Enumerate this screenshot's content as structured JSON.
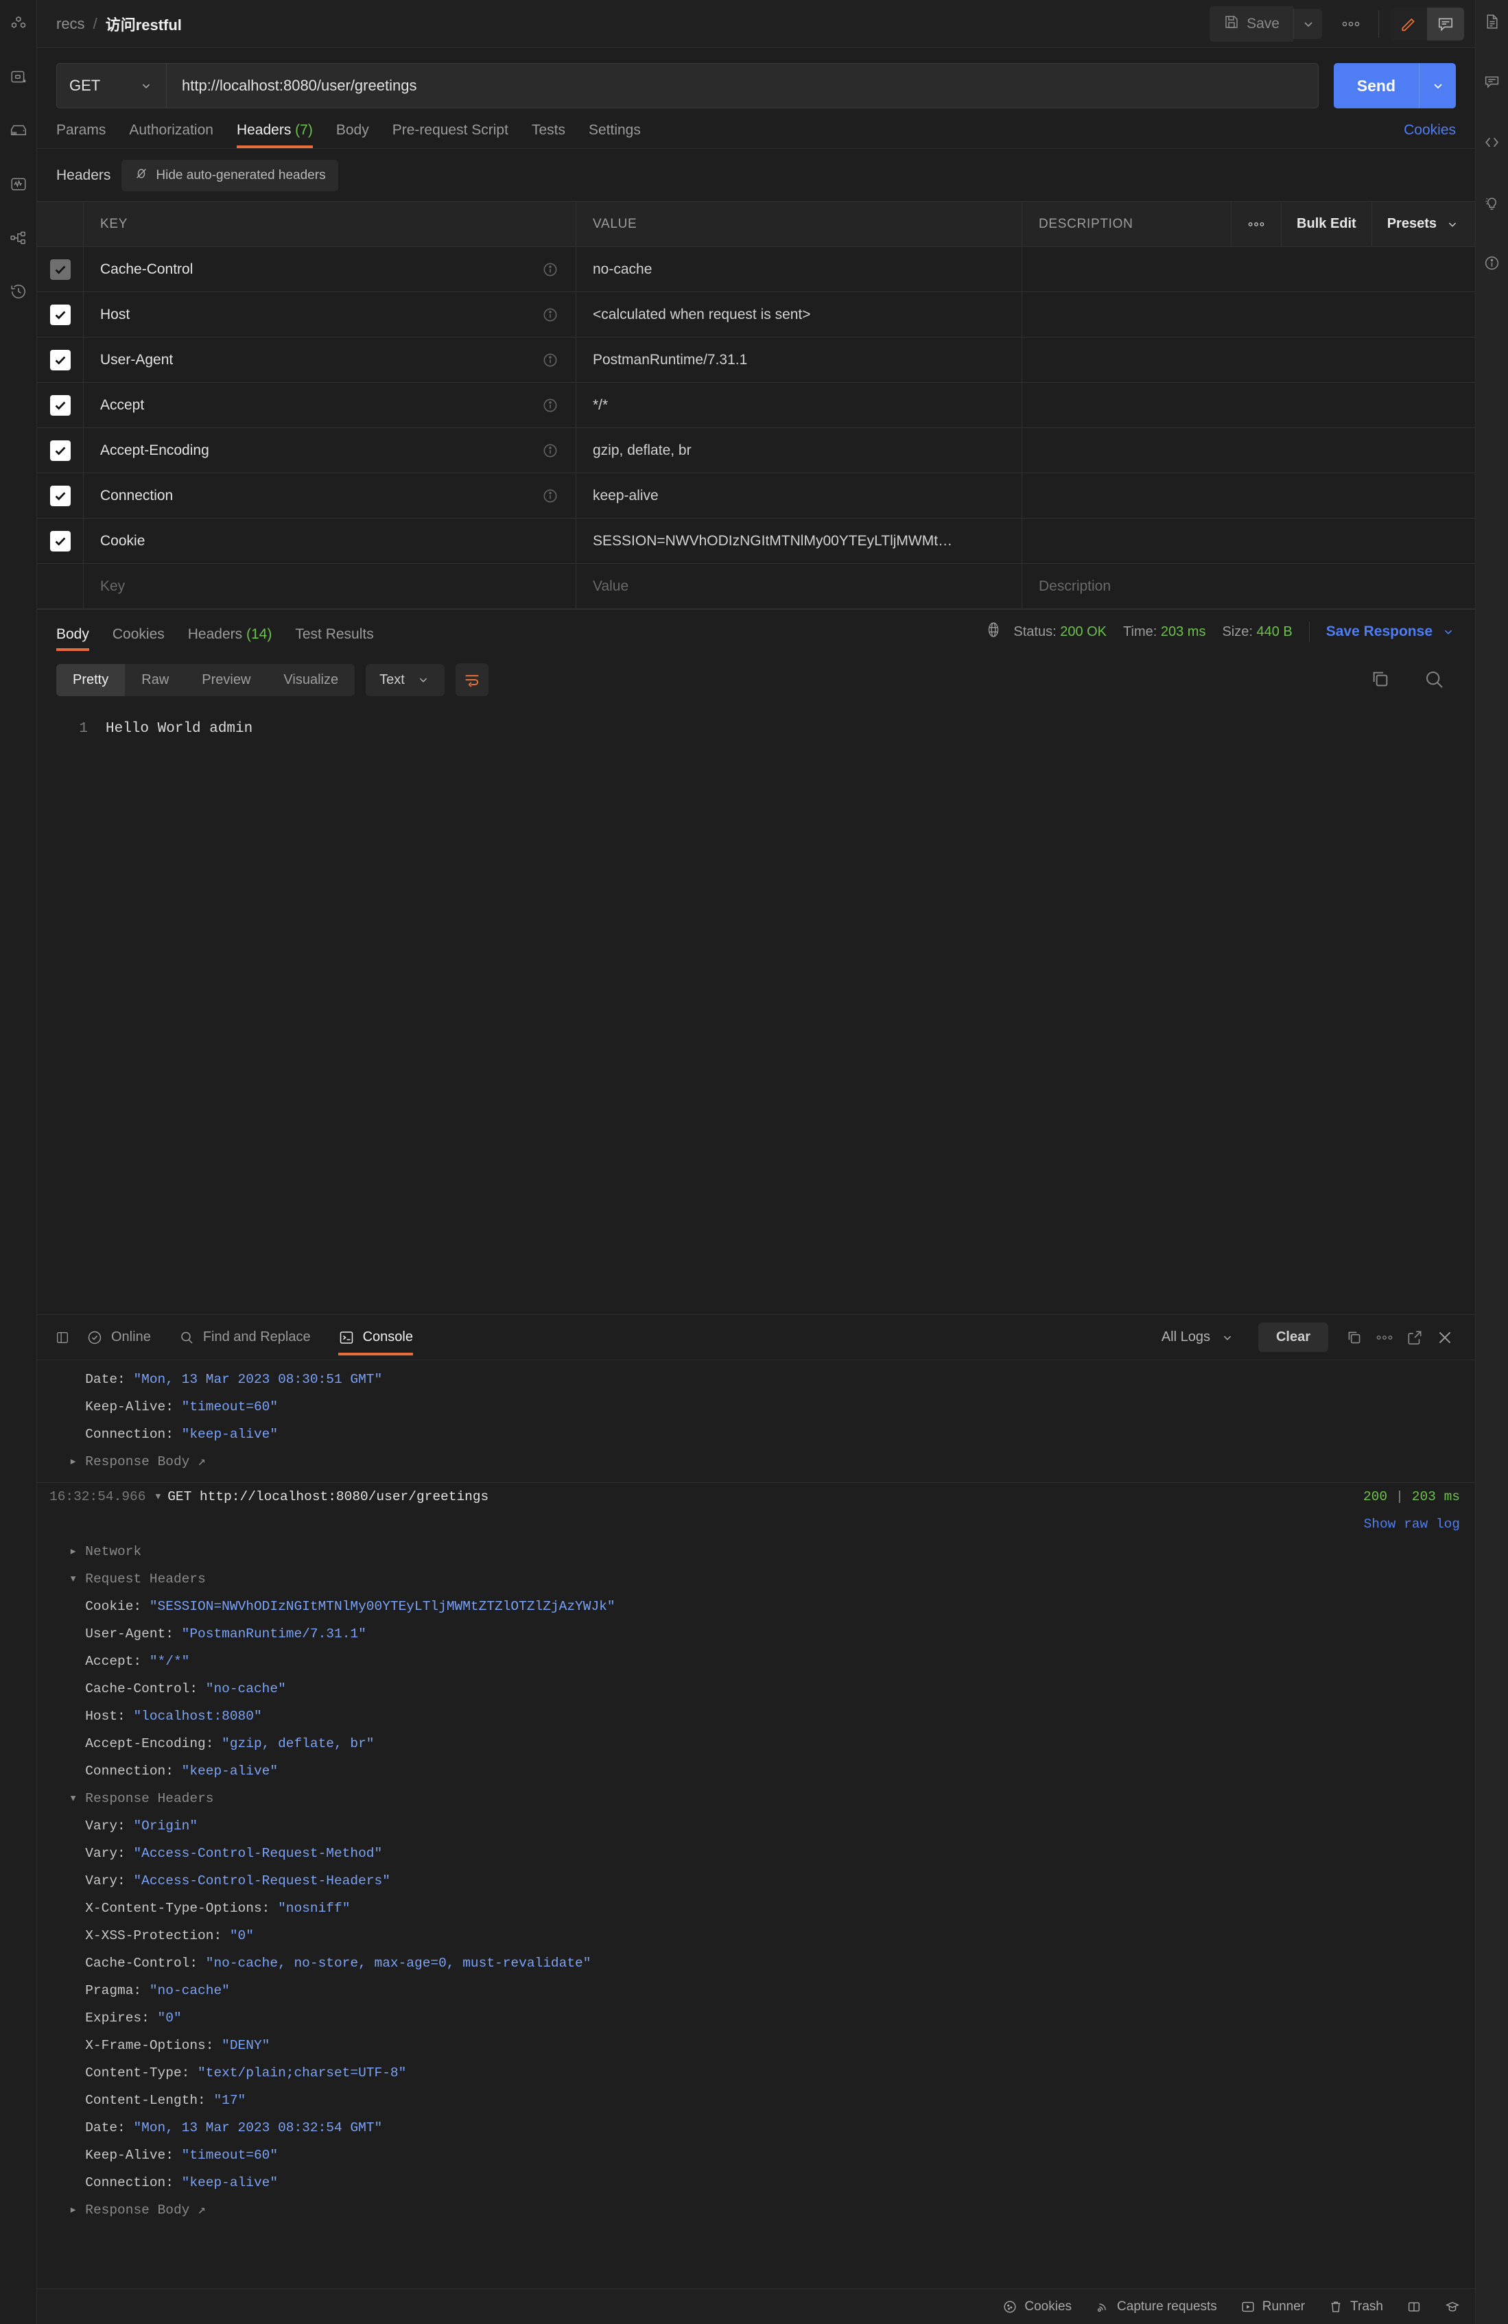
{
  "left_rail": [
    {
      "name": "collections-icon"
    },
    {
      "name": "apis-icon"
    },
    {
      "name": "environments-icon"
    },
    {
      "name": "monitors-icon"
    },
    {
      "name": "flows-icon"
    },
    {
      "name": "history-icon"
    }
  ],
  "right_rail": [
    {
      "name": "documentation-icon"
    },
    {
      "name": "comments-icon"
    },
    {
      "name": "code-icon"
    },
    {
      "name": "lightbulb-icon"
    },
    {
      "name": "info-icon"
    }
  ],
  "topbar": {
    "breadcrumb_root": "recs",
    "breadcrumb_sep": "/",
    "breadcrumb_current": "访问restful",
    "save_label": "Save"
  },
  "request": {
    "method": "GET",
    "url": "http://localhost:8080/user/greetings",
    "send_label": "Send",
    "tabs": [
      {
        "label": "Params",
        "count": "",
        "active": false
      },
      {
        "label": "Authorization",
        "count": "",
        "active": false
      },
      {
        "label": "Headers",
        "count": "(7)",
        "active": true
      },
      {
        "label": "Body",
        "count": "",
        "active": false
      },
      {
        "label": "Pre-request Script",
        "count": "",
        "active": false
      },
      {
        "label": "Tests",
        "count": "",
        "active": false
      },
      {
        "label": "Settings",
        "count": "",
        "active": false
      }
    ],
    "cookies_link": "Cookies",
    "headers_label": "Headers",
    "hide_auto_label": "Hide auto-generated headers",
    "table": {
      "columns": [
        "KEY",
        "VALUE",
        "DESCRIPTION"
      ],
      "bulk_edit_label": "Bulk Edit",
      "presets_label": "Presets",
      "key_placeholder": "Key",
      "value_placeholder": "Value",
      "description_placeholder": "Description",
      "rows": [
        {
          "checked": true,
          "dim": true,
          "key": "Cache-Control",
          "value": "no-cache",
          "info": true,
          "description": ""
        },
        {
          "checked": true,
          "dim": false,
          "key": "Host",
          "value": "<calculated when request is sent>",
          "info": true,
          "description": ""
        },
        {
          "checked": true,
          "dim": false,
          "key": "User-Agent",
          "value": "PostmanRuntime/7.31.1",
          "info": true,
          "description": ""
        },
        {
          "checked": true,
          "dim": false,
          "key": "Accept",
          "value": "*/*",
          "info": true,
          "description": ""
        },
        {
          "checked": true,
          "dim": false,
          "key": "Accept-Encoding",
          "value": "gzip, deflate, br",
          "info": true,
          "description": ""
        },
        {
          "checked": true,
          "dim": false,
          "key": "Connection",
          "value": "keep-alive",
          "info": true,
          "description": ""
        },
        {
          "checked": true,
          "dim": false,
          "key": "Cookie",
          "value": "SESSION=NWVhODIzNGItMTNlMy00YTEyLTljMWMt…",
          "info": false,
          "description": ""
        }
      ]
    }
  },
  "response": {
    "tabs": [
      {
        "label": "Body",
        "count": "",
        "active": true
      },
      {
        "label": "Cookies",
        "count": "",
        "active": false
      },
      {
        "label": "Headers",
        "count": "(14)",
        "active": false
      },
      {
        "label": "Test Results",
        "count": "",
        "active": false
      }
    ],
    "status_label": "Status:",
    "status_value": "200 OK",
    "time_label": "Time:",
    "time_value": "203 ms",
    "size_label": "Size:",
    "size_value": "440 B",
    "save_response_label": "Save Response",
    "view_modes": [
      {
        "label": "Pretty",
        "active": true
      },
      {
        "label": "Raw",
        "active": false
      },
      {
        "label": "Preview",
        "active": false
      },
      {
        "label": "Visualize",
        "active": false
      }
    ],
    "format_selected": "Text",
    "body_line_number": "1",
    "body_text": "Hello World admin"
  },
  "console": {
    "bottom_tabs": [
      {
        "label": "Online",
        "icon": "online-check-icon",
        "active": false
      },
      {
        "label": "Find and Replace",
        "icon": "search-icon",
        "active": false
      },
      {
        "label": "Console",
        "icon": "console-icon",
        "active": true
      }
    ],
    "filter_label": "All Logs",
    "clear_label": "Clear",
    "previous_entry_tail": [
      {
        "key": "Date:",
        "value": "\"Mon, 13 Mar 2023 08:30:51 GMT\"",
        "indent": 3
      },
      {
        "key": "Keep-Alive:",
        "value": "\"timeout=60\"",
        "indent": 3
      },
      {
        "key": "Connection:",
        "value": "\"keep-alive\"",
        "indent": 3
      }
    ],
    "previous_response_body_label": "Response Body",
    "entry": {
      "timestamp": "16:32:54.966",
      "title": "GET http://localhost:8080/user/greetings",
      "status": "200",
      "time": "203 ms",
      "raw_log_label": "Show raw log",
      "network_label": "Network",
      "request_headers_label": "Request Headers",
      "request_headers": [
        {
          "key": "Cookie:",
          "value": "\"SESSION=NWVhODIzNGItMTNlMy00YTEyLTljMWMtZTZlOTZlZjAzYWJk\""
        },
        {
          "key": "User-Agent:",
          "value": "\"PostmanRuntime/7.31.1\""
        },
        {
          "key": "Accept:",
          "value": "\"*/*\""
        },
        {
          "key": "Cache-Control:",
          "value": "\"no-cache\""
        },
        {
          "key": "Host:",
          "value": "\"localhost:8080\""
        },
        {
          "key": "Accept-Encoding:",
          "value": "\"gzip, deflate, br\""
        },
        {
          "key": "Connection:",
          "value": "\"keep-alive\""
        }
      ],
      "response_headers_label": "Response Headers",
      "response_headers": [
        {
          "key": "Vary:",
          "value": "\"Origin\""
        },
        {
          "key": "Vary:",
          "value": "\"Access-Control-Request-Method\""
        },
        {
          "key": "Vary:",
          "value": "\"Access-Control-Request-Headers\""
        },
        {
          "key": "X-Content-Type-Options:",
          "value": "\"nosniff\""
        },
        {
          "key": "X-XSS-Protection:",
          "value": "\"0\""
        },
        {
          "key": "Cache-Control:",
          "value": "\"no-cache, no-store, max-age=0, must-revalidate\""
        },
        {
          "key": "Pragma:",
          "value": "\"no-cache\""
        },
        {
          "key": "Expires:",
          "value": "\"0\""
        },
        {
          "key": "X-Frame-Options:",
          "value": "\"DENY\""
        },
        {
          "key": "Content-Type:",
          "value": "\"text/plain;charset=UTF-8\""
        },
        {
          "key": "Content-Length:",
          "value": "\"17\""
        },
        {
          "key": "Date:",
          "value": "\"Mon, 13 Mar 2023 08:32:54 GMT\""
        },
        {
          "key": "Keep-Alive:",
          "value": "\"timeout=60\""
        },
        {
          "key": "Connection:",
          "value": "\"keep-alive\""
        }
      ],
      "response_body_label": "Response Body"
    }
  },
  "statusbar": {
    "items": [
      {
        "label": "Cookies",
        "icon": "cookie-icon"
      },
      {
        "label": "Capture requests",
        "icon": "satellite-icon"
      },
      {
        "label": "Runner",
        "icon": "runner-icon"
      },
      {
        "label": "Trash",
        "icon": "trash-icon"
      }
    ],
    "layout_icon": "two-pane-icon",
    "help_icon": "graduation-cap-icon"
  },
  "colors": {
    "accent_orange": "#e86c3a",
    "accent_blue": "#4f7df3",
    "success_green": "#6cc24a",
    "value_blue": "#7aa2f7"
  }
}
